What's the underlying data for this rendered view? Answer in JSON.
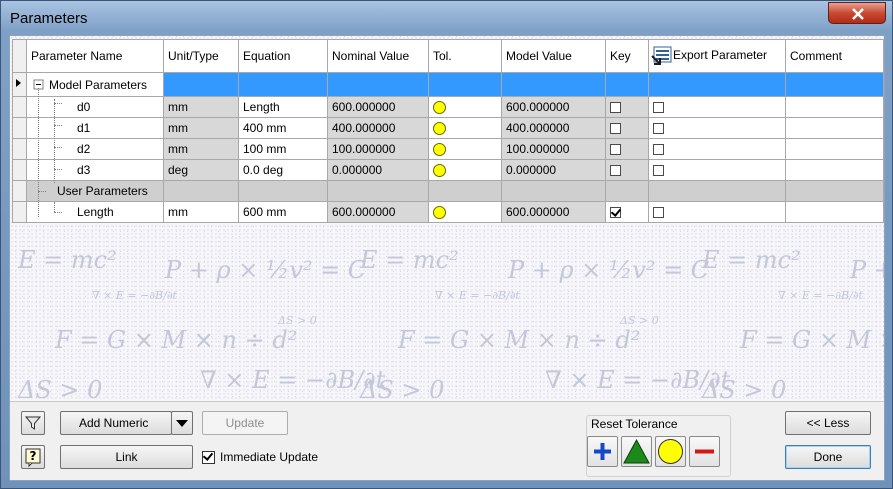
{
  "window": {
    "title": "Parameters"
  },
  "columns": [
    "Parameter Name",
    "Unit/Type",
    "Equation",
    "Nominal Value",
    "Tol.",
    "Model Value",
    "Key",
    "Export Parameter",
    "Comment"
  ],
  "groups": [
    {
      "label": "Model Parameters",
      "rows": [
        {
          "name": "d0",
          "unit": "mm",
          "equation": "Length",
          "nominal": "600.000000",
          "model": "600.000000",
          "key": false,
          "export": false,
          "comment": ""
        },
        {
          "name": "d1",
          "unit": "mm",
          "equation": "400 mm",
          "nominal": "400.000000",
          "model": "400.000000",
          "key": false,
          "export": false,
          "comment": ""
        },
        {
          "name": "d2",
          "unit": "mm",
          "equation": "100 mm",
          "nominal": "100.000000",
          "model": "100.000000",
          "key": false,
          "export": false,
          "comment": ""
        },
        {
          "name": "d3",
          "unit": "deg",
          "equation": "0.0 deg",
          "nominal": "0.000000",
          "model": "0.000000",
          "key": false,
          "export": false,
          "comment": ""
        }
      ]
    },
    {
      "label": "User Parameters",
      "rows": [
        {
          "name": "Length",
          "unit": "mm",
          "equation": "600 mm",
          "nominal": "600.000000",
          "model": "600.000000",
          "key": true,
          "export": false,
          "comment": ""
        }
      ]
    }
  ],
  "buttons": {
    "add_numeric": "Add Numeric",
    "update": "Update",
    "link": "Link",
    "immediate_update": "Immediate Update",
    "reset_tolerance": "Reset Tolerance",
    "less": "<< Less",
    "done": "Done"
  },
  "immediate_update_checked": true,
  "colors": {
    "selection": "#3399ff",
    "tolerance_dot": "#ffff00",
    "title_bar": "#7fa0c6",
    "close_button": "#c94a32"
  },
  "icons": [
    "filter-icon",
    "help-icon",
    "dropdown-arrow-icon",
    "plus-icon",
    "triangle-icon",
    "circle-icon",
    "minus-icon",
    "export-icon",
    "close-icon"
  ]
}
